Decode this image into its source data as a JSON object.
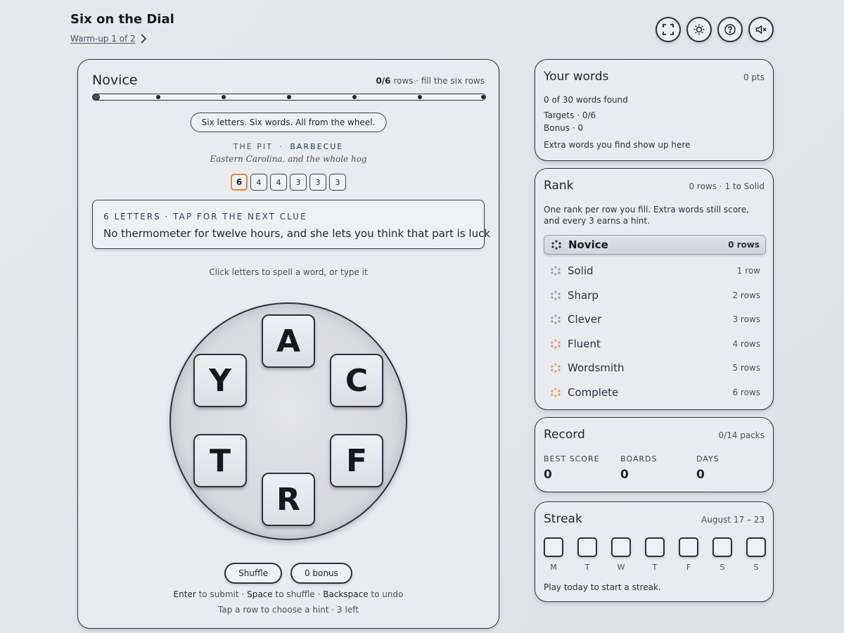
{
  "header": {
    "title": "Six on the Dial",
    "warmup": "Warm-up 1 of 2",
    "buttons": [
      {
        "name": "fullscreen-button",
        "icon": "fullscreen-icon"
      },
      {
        "name": "theme-button",
        "icon": "sun-icon"
      },
      {
        "name": "help-button",
        "icon": "help-icon"
      },
      {
        "name": "mute-button",
        "icon": "mute-icon"
      }
    ]
  },
  "game": {
    "rank_title": "Novice",
    "progress_count": "0/6",
    "progress_suffix": " rows · fill the six rows",
    "rows_filled": 0,
    "rows_total": 6,
    "info_pill": "Six letters. Six words. All from the wheel.",
    "category_pre": "THE PIT",
    "category_sep": "·",
    "category_main": "BARBECUE",
    "subtitle": "Eastern Carolina, and the whole hog",
    "lengths": [
      "6",
      "4",
      "4",
      "3",
      "3",
      "3"
    ],
    "active_length_index": 0,
    "clue_label": "6 LETTERS · TAP FOR THE NEXT CLUE",
    "clue_text": "No thermometer for twelve hours, and she lets you think that part is luck",
    "instruction": "Click letters to spell a word, or type it",
    "letters": [
      "A",
      "C",
      "F",
      "R",
      "T",
      "Y"
    ],
    "shuffle_label": "Shuffle",
    "bonus_label": "0 bonus",
    "help_enter": "Enter",
    "help_enter_txt": " to submit · ",
    "help_space": "Space",
    "help_space_txt": " to shuffle · ",
    "help_backspace": "Backspace",
    "help_backspace_txt": " to undo",
    "hint_line": "Tap a row to choose a hint · 3 left"
  },
  "words": {
    "title": "Your words",
    "points": "0 pts",
    "found": "0 of 30 words found",
    "targets": "Targets · 0/6",
    "bonus": "Bonus · 0",
    "extra": "Extra words you find show up here"
  },
  "rank": {
    "title": "Rank",
    "status": "0 rows · 1 to Solid",
    "desc": "One rank per row you fill. Extra words still score, and every 3 earns a hint.",
    "items": [
      {
        "name": "Novice",
        "rows": "0 rows",
        "dot_color": "#2a3240"
      },
      {
        "name": "Solid",
        "rows": "1 row",
        "dot_color": "#9aa0aa"
      },
      {
        "name": "Sharp",
        "rows": "2 rows",
        "dot_color": "#9aa0aa"
      },
      {
        "name": "Clever",
        "rows": "3 rows",
        "dot_color": "#9aa0aa"
      },
      {
        "name": "Fluent",
        "rows": "4 rows",
        "dot_color": "#c9a27a"
      },
      {
        "name": "Wordsmith",
        "rows": "5 rows",
        "dot_color": "#d4a06a"
      },
      {
        "name": "Complete",
        "rows": "6 rows",
        "dot_color": "#e0a060"
      }
    ]
  },
  "record": {
    "title": "Record",
    "packs": "0/14 packs",
    "stats": [
      {
        "label": "BEST SCORE",
        "value": "0"
      },
      {
        "label": "BOARDS",
        "value": "0"
      },
      {
        "label": "DAYS",
        "value": "0"
      }
    ]
  },
  "streak": {
    "title": "Streak",
    "range": "August 17 – 23",
    "days": [
      "M",
      "T",
      "W",
      "T",
      "F",
      "S",
      "S"
    ],
    "footer": "Play today to start a streak."
  }
}
